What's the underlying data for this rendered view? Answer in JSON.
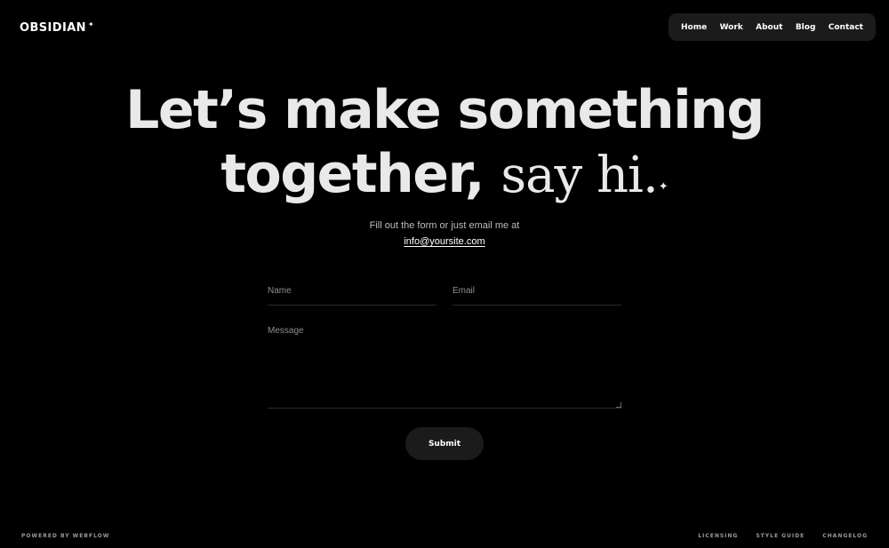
{
  "brand": {
    "name": "OBSIDIAN",
    "mark": "✦"
  },
  "nav": {
    "items": [
      "Home",
      "Work",
      "About",
      "Blog",
      "Contact"
    ]
  },
  "hero": {
    "line1": "Let’s make something",
    "line2_bold": "together,",
    "line2_serif": "say hi.",
    "sparkle": "✦"
  },
  "intro": {
    "text": "Fill out the form or just email me at",
    "email": "info@yoursite.com"
  },
  "form": {
    "name_placeholder": "Name",
    "email_placeholder": "Email",
    "message_placeholder": "Message",
    "submit_label": "Submit"
  },
  "footer": {
    "powered_by": "POWERED BY WEBFLOW",
    "links": [
      "LICENSING",
      "STYLE GUIDE",
      "CHANGELOG"
    ]
  },
  "colors": {
    "background": "#000000",
    "surface": "#1b1b1b",
    "text": "#e9e9e9",
    "muted": "#8e8e8e"
  }
}
